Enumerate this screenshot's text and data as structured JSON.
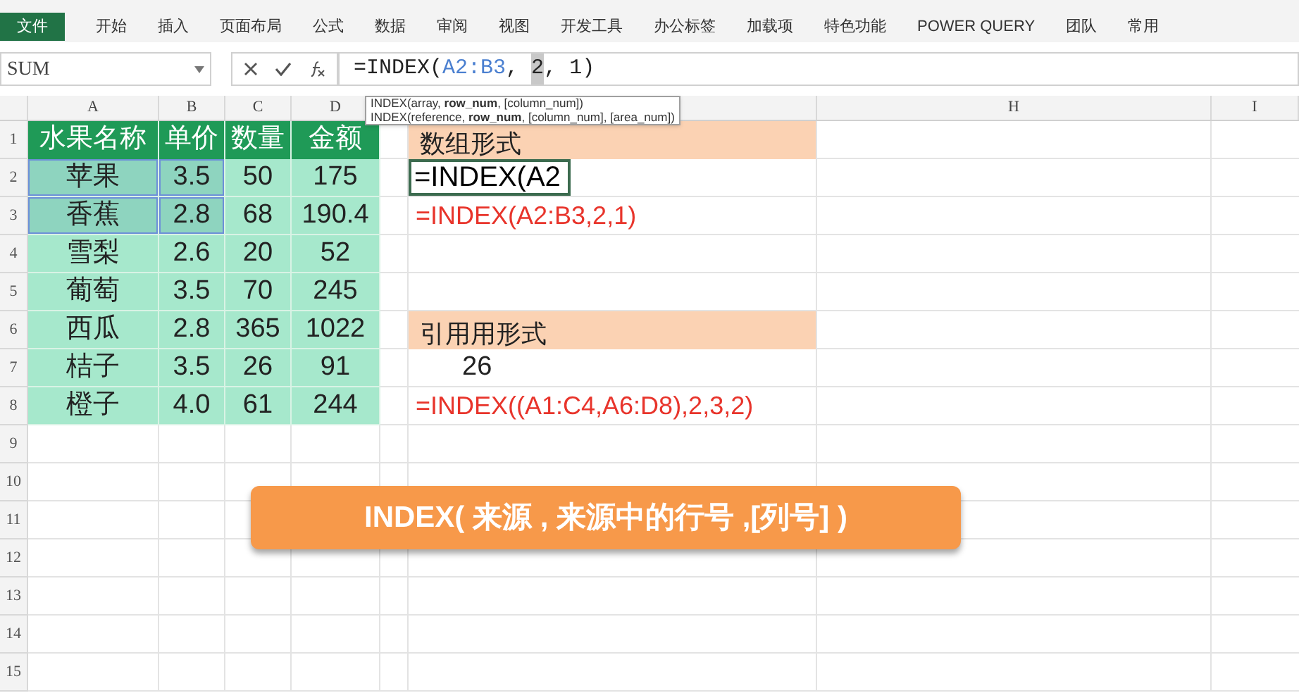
{
  "ribbon": {
    "tabs": [
      {
        "label": "文件",
        "selected": true
      },
      {
        "label": "开始",
        "selected": false
      },
      {
        "label": "插入",
        "selected": false
      },
      {
        "label": "页面布局",
        "selected": false
      },
      {
        "label": "公式",
        "selected": false
      },
      {
        "label": "数据",
        "selected": false
      },
      {
        "label": "审阅",
        "selected": false
      },
      {
        "label": "视图",
        "selected": false
      },
      {
        "label": "开发工具",
        "selected": false
      },
      {
        "label": "办公标签",
        "selected": false
      },
      {
        "label": "加载项",
        "selected": false
      },
      {
        "label": "特色功能",
        "selected": false
      },
      {
        "label": "POWER QUERY",
        "selected": false
      },
      {
        "label": "团队",
        "selected": false
      },
      {
        "label": "常用",
        "selected": false
      }
    ]
  },
  "formula_bar": {
    "name_box": "SUM",
    "formula": [
      {
        "kind": "text",
        "text": "=INDEX("
      },
      {
        "kind": "reference",
        "text": "A2:B3"
      },
      {
        "kind": "text",
        "text": ", "
      },
      {
        "kind": "current",
        "text": "2"
      },
      {
        "kind": "text",
        "text": ", 1)"
      }
    ]
  },
  "tooltip": [
    "INDEX(array, **row_num**, [column_num])",
    "INDEX(reference, **row_num**, [column_num], [area_num])"
  ],
  "column_headers": [
    "A",
    "B",
    "C",
    "D",
    "H",
    "I"
  ],
  "row_headers": [
    "1",
    "2",
    "3",
    "4",
    "5",
    "6",
    "7",
    "8",
    "9",
    "10",
    "11",
    "12",
    "13",
    "14",
    "15"
  ],
  "table": {
    "header": [
      "水果名称",
      "单价",
      "数量",
      "金额"
    ],
    "rows": [
      {
        "cells": [
          "苹果",
          "3.5",
          "50",
          "175"
        ],
        "highlighted": true
      },
      {
        "cells": [
          "香蕉",
          "2.8",
          "68",
          "190.4"
        ],
        "highlighted": true
      },
      {
        "cells": [
          "雪梨",
          "2.6",
          "20",
          "52"
        ],
        "highlighted": false
      },
      {
        "cells": [
          "葡萄",
          "3.5",
          "70",
          "245"
        ],
        "highlighted": false
      },
      {
        "cells": [
          "西瓜",
          "2.8",
          "365",
          "1022"
        ],
        "highlighted": false
      },
      {
        "cells": [
          "桔子",
          "3.5",
          "26",
          "91"
        ],
        "highlighted": false
      },
      {
        "cells": [
          "橙子",
          "4.0",
          "61",
          "244"
        ],
        "highlighted": false
      }
    ]
  },
  "notes": [
    {
      "kind": "heading",
      "text": "数组形式"
    },
    {
      "kind": "editing",
      "text": "=INDEX(A2"
    },
    {
      "kind": "formula",
      "text": "=INDEX(A2:B3,2,1)"
    },
    {
      "kind": "empty"
    },
    {
      "kind": "empty"
    },
    {
      "kind": "heading",
      "text": "引用用形式"
    },
    {
      "kind": "value",
      "text": "26"
    },
    {
      "kind": "formula",
      "text": "=INDEX((A1:C4,A6:D8),2,3,2)"
    }
  ],
  "banner": "INDEX( 来源 , 来源中的行号 ,[列号] )"
}
